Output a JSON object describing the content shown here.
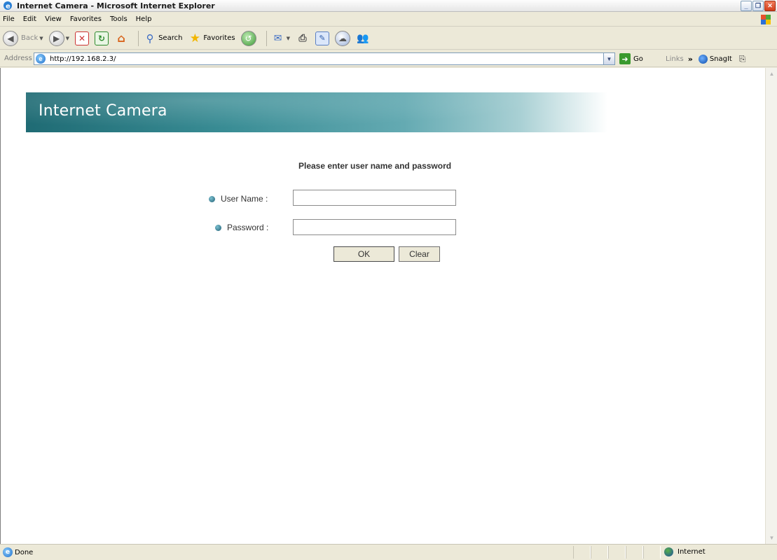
{
  "window": {
    "title": "Internet Camera - Microsoft Internet Explorer",
    "buttons": [
      "minimize",
      "restore",
      "close"
    ]
  },
  "menu": {
    "items": [
      "File",
      "Edit",
      "View",
      "Favorites",
      "Tools",
      "Help"
    ]
  },
  "toolbar": {
    "back_label": "Back",
    "search_label": "Search",
    "favorites_label": "Favorites",
    "icons": [
      "back-icon",
      "forward-icon",
      "stop-icon",
      "refresh-icon",
      "home-icon",
      "search-icon",
      "favorites-star-icon",
      "history-icon",
      "mail-icon",
      "print-icon",
      "edit-icon",
      "discuss-icon",
      "messenger-icon"
    ]
  },
  "address": {
    "label": "Address",
    "url": "http://192.168.2.3/",
    "go_label": "Go",
    "links_label": "Links",
    "snagit_label": "SnagIt"
  },
  "page": {
    "banner_title": "Internet Camera",
    "prompt": "Please enter user name and password",
    "username_label": "User Name :",
    "password_label": "Password :",
    "username_value": "",
    "password_value": "",
    "ok_label": "OK",
    "clear_label": "Clear",
    "banner_color": "#2e7f88"
  },
  "status": {
    "text": "Done",
    "zone": "Internet"
  }
}
